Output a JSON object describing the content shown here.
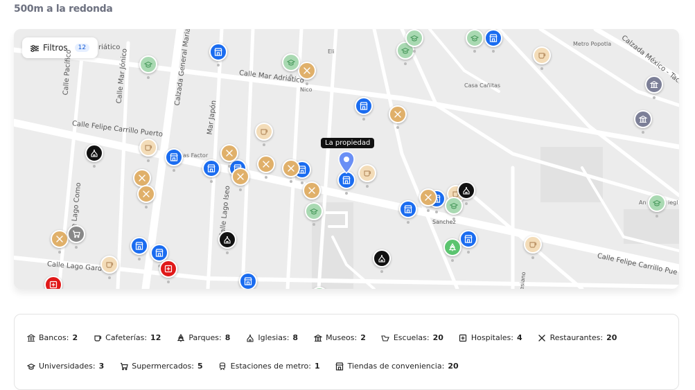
{
  "header": {
    "title": "500m a la redonda"
  },
  "filters": {
    "label": "Filtros",
    "count": "12"
  },
  "map": {
    "property_label": "La propiedad",
    "streets": [
      {
        "key": "mar_adriatico",
        "text": "Calle Mar Adriático"
      },
      {
        "key": "felipe_1",
        "text": "Calle Felipe Carrillo Puerto"
      },
      {
        "key": "felipe_2",
        "text": "Calle Felipe Carrillo Pue"
      },
      {
        "key": "general_mariano",
        "text": "Calzada General Mariano"
      },
      {
        "key": "mar_japon",
        "text": "Mar Japón"
      },
      {
        "key": "mar_jonico",
        "text": "Calle Mar Jónico"
      },
      {
        "key": "pacifico",
        "text": "Calle Pacífico"
      },
      {
        "key": "lago_como",
        "text": "Calle Lago Como"
      },
      {
        "key": "lago_iseo",
        "text": "Calle Lago Iseo"
      },
      {
        "key": "lago_garda",
        "text": "Calle Lago Garda"
      },
      {
        "key": "calzada_mexico",
        "text": "Calzada México - Tacuba"
      },
      {
        "key": "adriatico_partial",
        "text": "riático"
      },
      {
        "key": "sanchez",
        "text": "Sanchez"
      },
      {
        "key": "esiano",
        "text": "esiano"
      }
    ],
    "places": [
      {
        "key": "eli",
        "text": "Eli"
      },
      {
        "key": "metro",
        "text": "Metro Popotla"
      },
      {
        "key": "canitas",
        "text": "Casa Cañitas"
      },
      {
        "key": "nico",
        "text": "Nico"
      },
      {
        "key": "factor",
        "text": "as Factor"
      },
      {
        "key": "an",
        "text": "An"
      },
      {
        "key": "iegl",
        "text": "iegl"
      }
    ],
    "colors": {
      "tienda": "#1a6cf0",
      "restaurante": "#e0b06a",
      "cafeteria": "#f3dcb8",
      "escuela": "#a9d9b2",
      "iglesia": "#111111",
      "hospital": "#e01919",
      "museo": "#7c7f97",
      "supermercado": "#888888",
      "parque": "#5bc46f",
      "propiedad": "#6a8ff5"
    }
  },
  "legend": {
    "items": [
      {
        "icon": "bank-icon",
        "label": "Bancos:",
        "count": "2"
      },
      {
        "icon": "cafe-icon",
        "label": "Cafeterías:",
        "count": "12"
      },
      {
        "icon": "park-icon",
        "label": "Parques:",
        "count": "8"
      },
      {
        "icon": "church-icon",
        "label": "Iglesias:",
        "count": "8"
      },
      {
        "icon": "museum-icon",
        "label": "Museos:",
        "count": "2"
      },
      {
        "icon": "school-icon",
        "label": "Escuelas:",
        "count": "20"
      },
      {
        "icon": "hospital-icon",
        "label": "Hospitales:",
        "count": "4"
      },
      {
        "icon": "restaurant-icon",
        "label": "Restaurantes:",
        "count": "20"
      },
      {
        "icon": "university-icon",
        "label": "Universidades:",
        "count": "3"
      },
      {
        "icon": "cart-icon",
        "label": "Supermercados:",
        "count": "5"
      },
      {
        "icon": "metro-icon",
        "label": "Estaciones de metro:",
        "count": "1"
      },
      {
        "icon": "store-icon",
        "label": "Tiendas de conveniencia:",
        "count": "20"
      }
    ]
  }
}
